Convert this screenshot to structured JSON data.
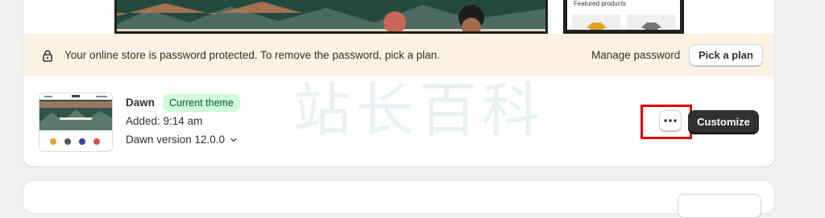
{
  "preview": {
    "mobile_heading": "Featured products"
  },
  "banner": {
    "lock_icon": "lock-icon",
    "message": "Your online store is password protected. To remove the password, pick a plan.",
    "manage_label": "Manage password",
    "pick_plan_label": "Pick a plan",
    "background": "#fdf1e4"
  },
  "theme": {
    "name": "Dawn",
    "badge": "Current theme",
    "added": "Added: 9:14 am",
    "version": "Dawn version 12.0.0",
    "more_icon": "ellipsis-icon",
    "customize_label": "Customize",
    "badge_color": "#cdfed4",
    "primary_button_color": "#303030"
  },
  "watermark": {
    "text": "站长百科"
  },
  "annotation": {
    "highlight_color": "#e00000"
  }
}
